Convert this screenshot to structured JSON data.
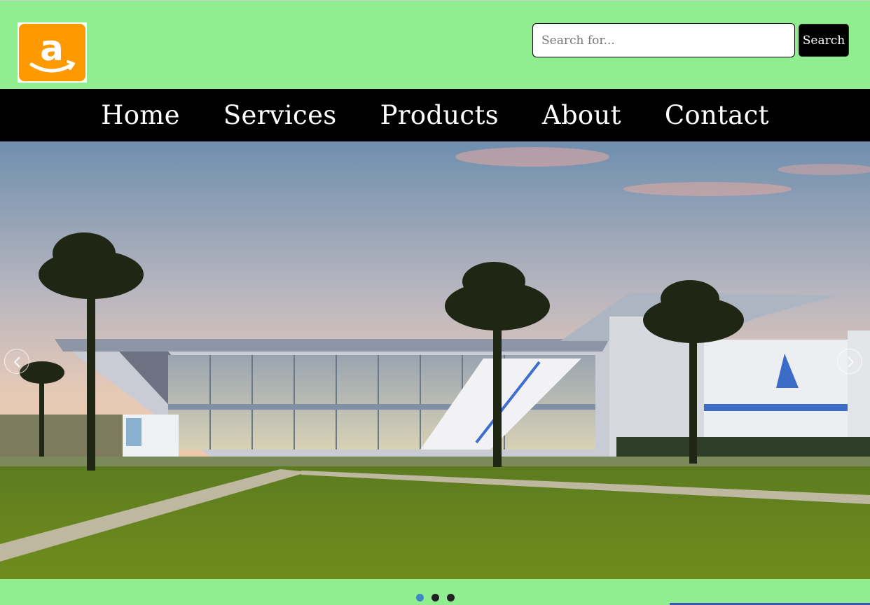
{
  "header": {
    "logo_name": "amazon-logo",
    "logo_letter": "a"
  },
  "search": {
    "placeholder": "Search for...",
    "value": "",
    "button_label": "Search"
  },
  "nav": {
    "items": [
      {
        "label": "Home"
      },
      {
        "label": "Services"
      },
      {
        "label": "Products"
      },
      {
        "label": "About"
      },
      {
        "label": "Contact"
      }
    ]
  },
  "carousel": {
    "slide_count": 3,
    "active_index": 0,
    "prev_icon": "chevron-left-icon",
    "next_icon": "chevron-right-icon"
  },
  "colors": {
    "header_bg": "#90ee90",
    "nav_bg": "#000000",
    "logo_orange": "#ff9900",
    "active_dot": "#3f88c5",
    "inactive_dot": "#222222"
  }
}
